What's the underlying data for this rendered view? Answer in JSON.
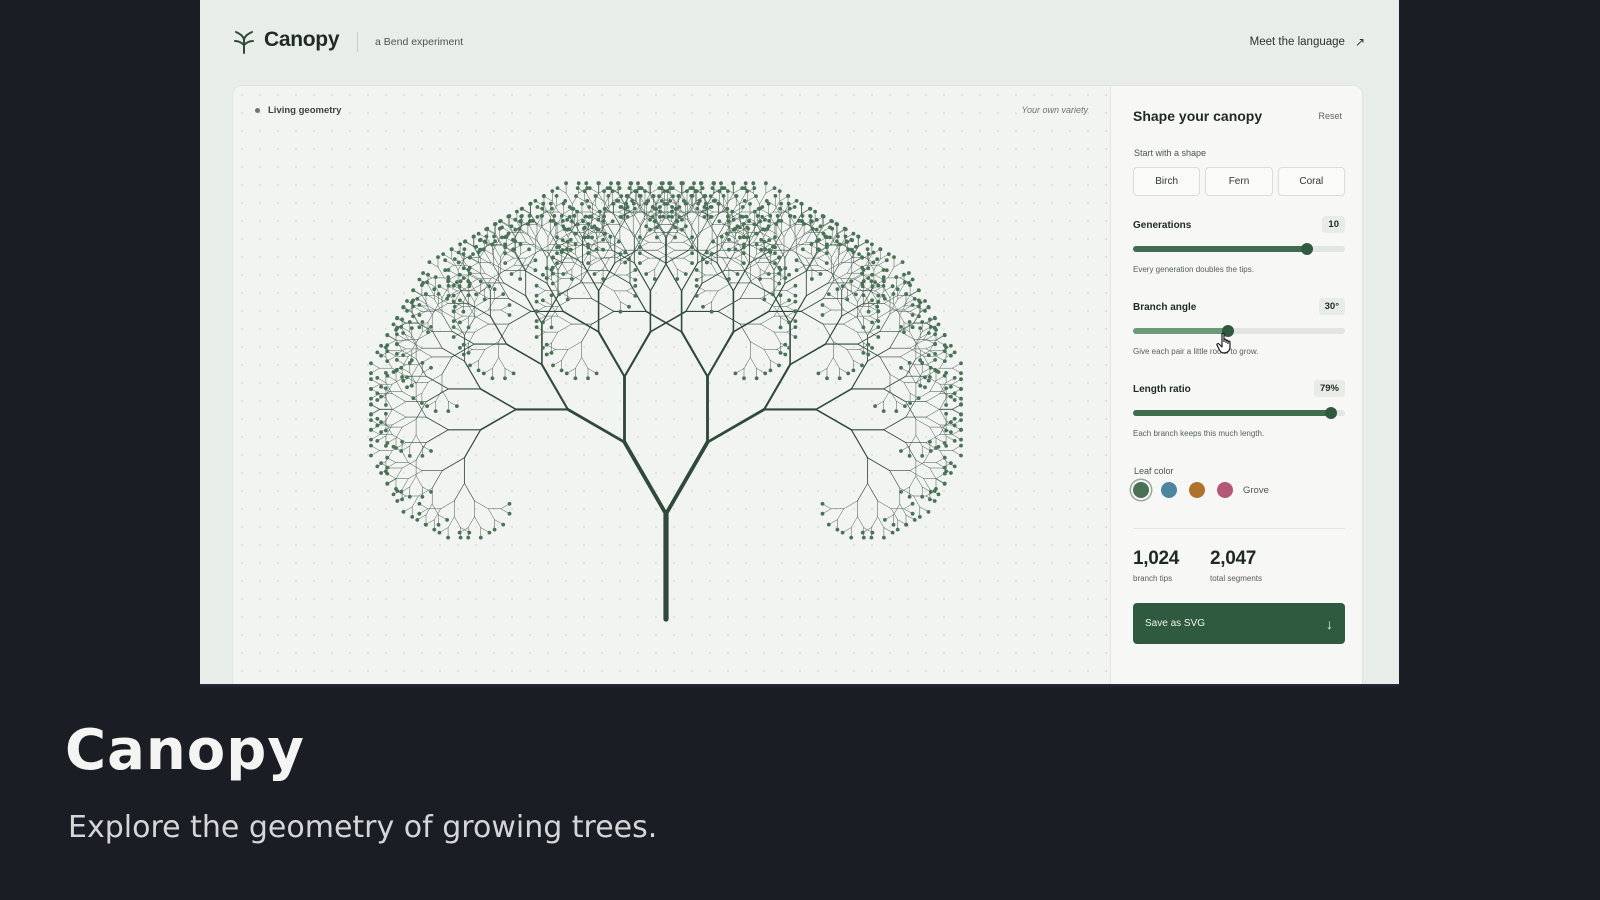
{
  "header": {
    "logo_text": "Canopy",
    "tagline": "a Bend experiment",
    "link_label": "Meet the language",
    "icons": [
      "sprout-logo-icon",
      "arrow-up-right-icon"
    ]
  },
  "canvas": {
    "badge_label": "Living geometry",
    "variety_label": "Your own variety"
  },
  "panel": {
    "title": "Shape your canopy",
    "reset_label": "Reset",
    "shapes_label": "Start with a shape",
    "shapes": [
      "Birch",
      "Fern",
      "Coral"
    ],
    "generations": {
      "label": "Generations",
      "value_text": "10",
      "value": 10,
      "fraction": 0.82,
      "hint": "Every generation doubles the tips."
    },
    "angle": {
      "label": "Branch angle",
      "value_text": "30°",
      "value": 30,
      "fraction": 0.45,
      "hint": "Give each pair a little room to grow."
    },
    "ratio": {
      "label": "Length ratio",
      "value_text": "79%",
      "value": 79,
      "fraction": 0.935,
      "hint": "Each branch keeps this much length."
    },
    "leaf_color": {
      "label": "Leaf color",
      "selected_name": "Grove",
      "swatches": [
        "#4a7256",
        "#4c86a0",
        "#b0702e",
        "#b35878"
      ]
    },
    "stats": {
      "tips_value": "1,024",
      "tips_label": "branch tips",
      "segments_value": "2,047",
      "segments_label": "total segments"
    },
    "save_label": "Save as SVG"
  },
  "colors": {
    "accent": "#2f5a3f",
    "trunk": "#2f4a3a",
    "leaf": "#4a7256"
  },
  "caption": {
    "title": "Canopy",
    "subtitle": "Explore the geometry of growing trees."
  }
}
